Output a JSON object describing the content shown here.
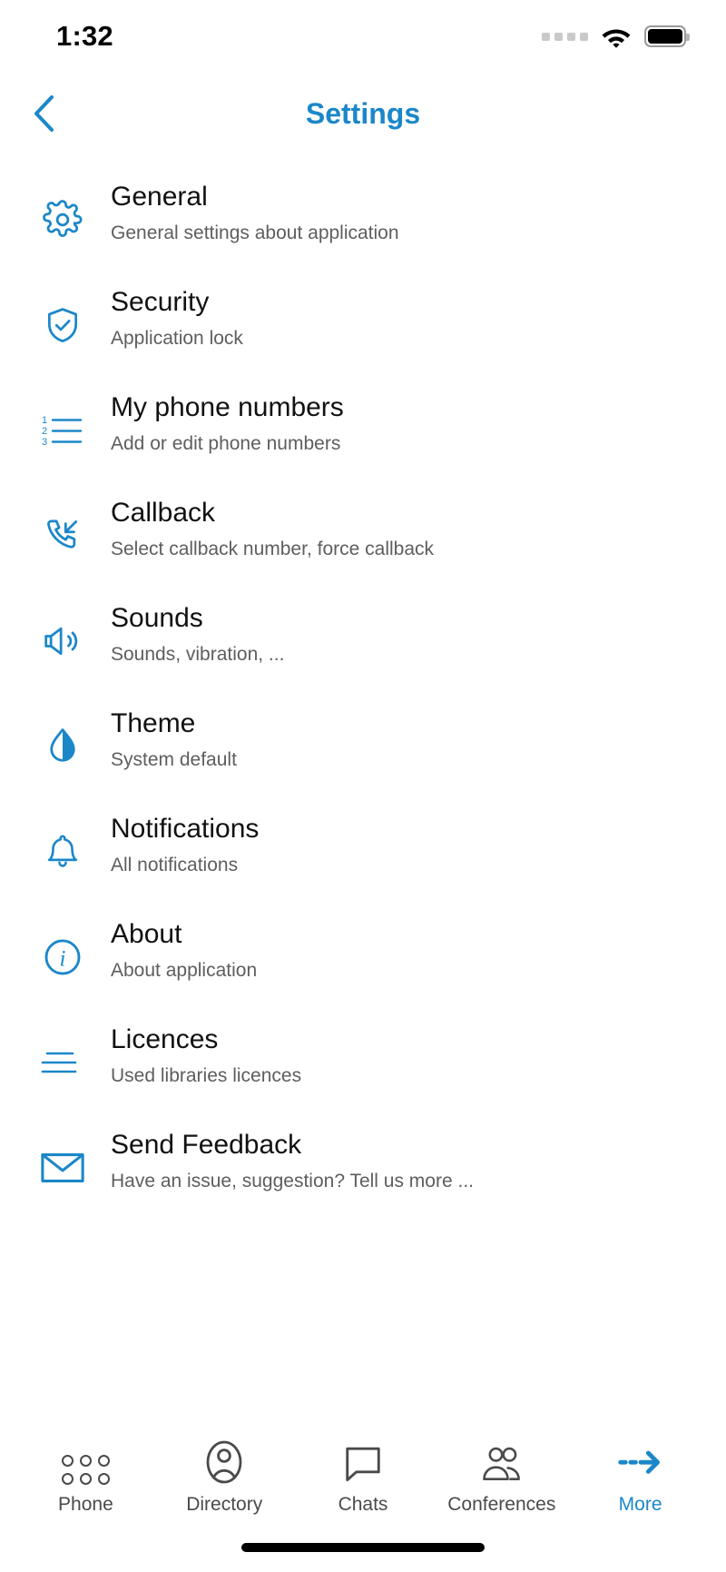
{
  "status_bar": {
    "time": "1:32",
    "signal_icon": "signal-dots-icon",
    "wifi_icon": "wifi-icon",
    "battery_icon": "battery-full-icon"
  },
  "nav": {
    "back_icon": "chevron-left-icon",
    "title": "Settings",
    "accent_color": "#1b87c9"
  },
  "settings": {
    "items": [
      {
        "title": "General",
        "subtitle": "General settings about application",
        "icon": "gear-icon"
      },
      {
        "title": "Security",
        "subtitle": "Application lock",
        "icon": "shield-check-icon"
      },
      {
        "title": "My phone numbers",
        "subtitle": "Add or edit phone numbers",
        "icon": "numbered-list-icon"
      },
      {
        "title": "Callback",
        "subtitle": "Select callback number, force callback",
        "icon": "phone-incoming-icon"
      },
      {
        "title": "Sounds",
        "subtitle": "Sounds, vibration, ...",
        "icon": "speaker-icon"
      },
      {
        "title": "Theme",
        "subtitle": "System default",
        "icon": "droplet-half-icon"
      },
      {
        "title": "Notifications",
        "subtitle": "All notifications",
        "icon": "bell-icon"
      },
      {
        "title": "About",
        "subtitle": "About application",
        "icon": "info-circle-icon"
      },
      {
        "title": "Licences",
        "subtitle": "Used libraries licences",
        "icon": "lines-icon"
      },
      {
        "title": "Send Feedback",
        "subtitle": "Have an issue, suggestion? Tell us more ...",
        "icon": "envelope-icon"
      }
    ]
  },
  "tabbar": {
    "tabs": [
      {
        "label": "Phone",
        "icon": "dialpad-icon",
        "active": false
      },
      {
        "label": "Directory",
        "icon": "contact-icon",
        "active": false
      },
      {
        "label": "Chats",
        "icon": "chat-bubble-icon",
        "active": false
      },
      {
        "label": "Conferences",
        "icon": "group-icon",
        "active": false
      },
      {
        "label": "More",
        "icon": "arrow-right-dashed-icon",
        "active": true
      }
    ]
  }
}
